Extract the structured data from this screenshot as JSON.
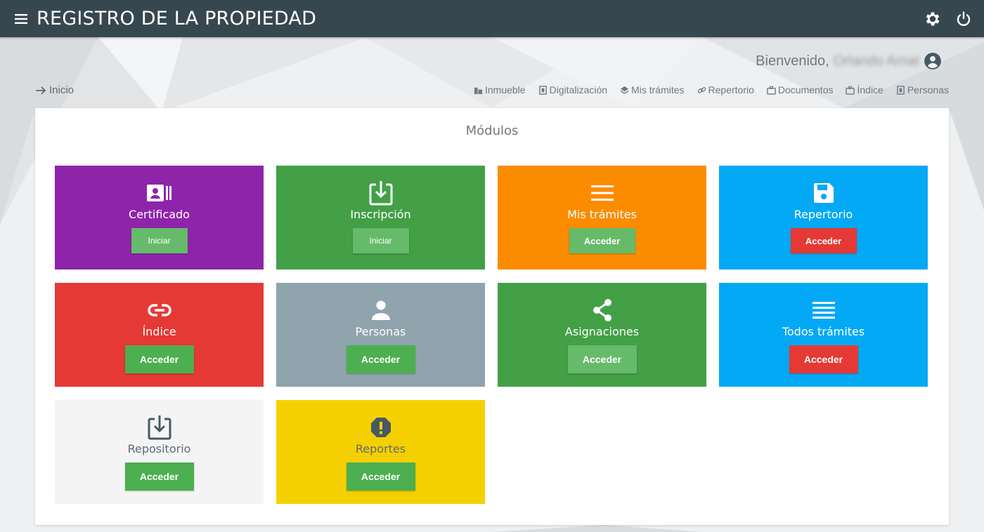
{
  "app": {
    "title": "REGISTRO DE LA PROPIEDAD"
  },
  "welcome": {
    "greeting": "Bienvenido,",
    "user_name": "Orlando Amat"
  },
  "breadcrumb": {
    "label": "Inicio"
  },
  "quicknav": [
    {
      "label": "Inmueble",
      "icon": "building-icon"
    },
    {
      "label": "Digitalización",
      "icon": "document-icon"
    },
    {
      "label": "Mis trámites",
      "icon": "layers-icon"
    },
    {
      "label": "Repertorio",
      "icon": "link-icon"
    },
    {
      "label": "Documentos",
      "icon": "briefcase-icon"
    },
    {
      "label": "Índice",
      "icon": "briefcase-icon"
    },
    {
      "label": "Personas",
      "icon": "document-icon"
    }
  ],
  "panel": {
    "title": "Módulos"
  },
  "modules": [
    {
      "label": "Certificado",
      "button": "Iniciar",
      "icon": "id-card-icon",
      "color": "#8e24aa",
      "button_color": "#66bb6a"
    },
    {
      "label": "Inscripción",
      "button": "Iniciar",
      "icon": "download-box-icon",
      "color": "#43a047",
      "button_color": "#66bb6a"
    },
    {
      "label": "Mis trámites",
      "button": "Acceder",
      "icon": "menu-lines-icon",
      "color": "#fb8c00",
      "button_color": "#66bb6a"
    },
    {
      "label": "Repertorio",
      "button": "Acceder",
      "icon": "floppy-icon",
      "color": "#03a9f4",
      "button_color": "#e53935"
    },
    {
      "label": "Índice",
      "button": "Acceder",
      "icon": "link-icon",
      "color": "#e53935",
      "button_color": "#4caf50"
    },
    {
      "label": "Personas",
      "button": "Acceder",
      "icon": "person-icon",
      "color": "#90a4ae",
      "button_color": "#4caf50"
    },
    {
      "label": "Asignaciones",
      "button": "Acceder",
      "icon": "share-icon",
      "color": "#43a047",
      "button_color": "#66bb6a"
    },
    {
      "label": "Todos trámites",
      "button": "Acceder",
      "icon": "list-lines-icon",
      "color": "#03a9f4",
      "button_color": "#e53935"
    },
    {
      "label": "Repositorio",
      "button": "Acceder",
      "icon": "download-box-icon",
      "color": "#f4f4f4",
      "button_color": "#4caf50"
    },
    {
      "label": "Reportes",
      "button": "Acceder",
      "icon": "alert-icon",
      "color": "#f5d000",
      "button_color": "#4caf50"
    }
  ]
}
